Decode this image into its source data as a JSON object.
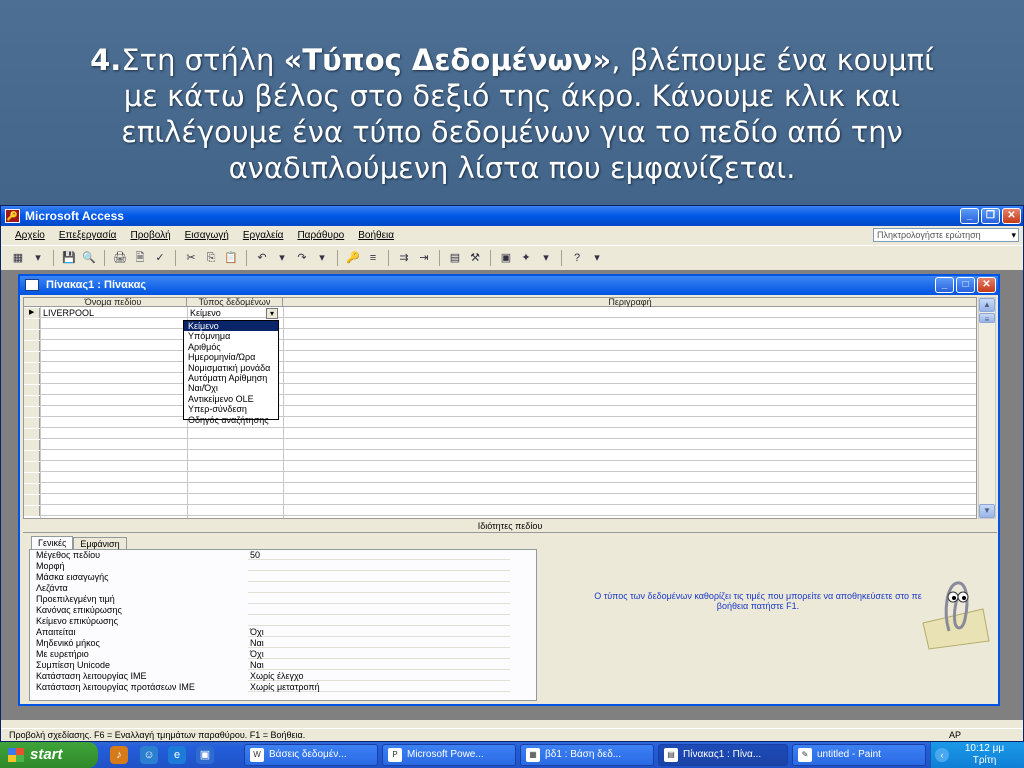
{
  "slide": {
    "num": "4.",
    "part1": "Στη στήλη ",
    "bold": "«Τύπος Δεδομένων»",
    "part2": ", βλέπουμε ένα κουμπί",
    "line2": "με κάτω βέλος στο δεξιό της άκρο. Κάνουμε κλικ και",
    "line3": "επιλέγουμε ένα τύπο δεδομένων για το πεδίο από την",
    "line4": "αναδιπλούμενη λίστα που εμφανίζεται."
  },
  "app": {
    "title": "Microsoft Access",
    "menu": [
      "Αρχείο",
      "Επεξεργασία",
      "Προβολή",
      "Εισαγωγή",
      "Εργαλεία",
      "Παράθυρο",
      "Βοήθεια"
    ],
    "help_placeholder": "Πληκτρολογήστε ερώτηση"
  },
  "table_window": {
    "title": "Πίνακας1 : Πίνακας",
    "headers": {
      "field": "Όνομα πεδίου",
      "type": "Τύπος δεδομένων",
      "desc": "Περιγραφή"
    },
    "row1": {
      "field": "LIVERPOOL",
      "type": "Κείμενο"
    },
    "dropdown": [
      "Κείμενο",
      "Υπόμνημα",
      "Αριθμός",
      "Ημερομηνία/Ώρα",
      "Νομισματική μονάδα",
      "Αυτόματη Αρίθμηση",
      "Ναι/Όχι",
      "Αντικείμενο OLE",
      "Υπερ-σύνδεση",
      "Οδηγός αναζήτησης"
    ],
    "props_label": "Ιδιότητες πεδίου",
    "tabs": {
      "general": "Γενικές",
      "lookup": "Εμφάνιση"
    },
    "props": [
      {
        "name": "Μέγεθος πεδίου",
        "value": "50"
      },
      {
        "name": "Μορφή",
        "value": ""
      },
      {
        "name": "Μάσκα εισαγωγής",
        "value": ""
      },
      {
        "name": "Λεζάντα",
        "value": ""
      },
      {
        "name": "Προεπιλεγμένη τιμή",
        "value": ""
      },
      {
        "name": "Κανόνας επικύρωσης",
        "value": ""
      },
      {
        "name": "Κείμενο επικύρωσης",
        "value": ""
      },
      {
        "name": "Απαιτείται",
        "value": "Όχι"
      },
      {
        "name": "Μηδενικό μήκος",
        "value": "Ναι"
      },
      {
        "name": "Με ευρετήριο",
        "value": "Όχι"
      },
      {
        "name": "Συμπίεση Unicode",
        "value": "Ναι"
      },
      {
        "name": "Κατάσταση λειτουργίας IME",
        "value": "Χωρίς έλεγχο"
      },
      {
        "name": "Κατάσταση λειτουργίας προτάσεων IME",
        "value": "Χωρίς μετατροπή"
      }
    ],
    "hint_line1": "Ο τύπος των δεδομένων καθορίζει τις τιμές που μπορείτε να αποθηκεύσετε στο πε",
    "hint_line2": "βοήθεια πατήστε F1."
  },
  "status": {
    "text": "Προβολή σχεδίασης. F6 = Εναλλαγή τμημάτων παραθύρου. F1 = Βοήθεια.",
    "right": "ΑΡ"
  },
  "taskbar": {
    "start": "start",
    "tasks": [
      "Βάσεις δεδομέν...",
      "Microsoft Powe...",
      "βδ1 : Βάση δεδ...",
      "Πίνακας1 : Πίνα...",
      "untitled - Paint"
    ],
    "time": "10:12 μμ",
    "day": "Τρίτη"
  }
}
